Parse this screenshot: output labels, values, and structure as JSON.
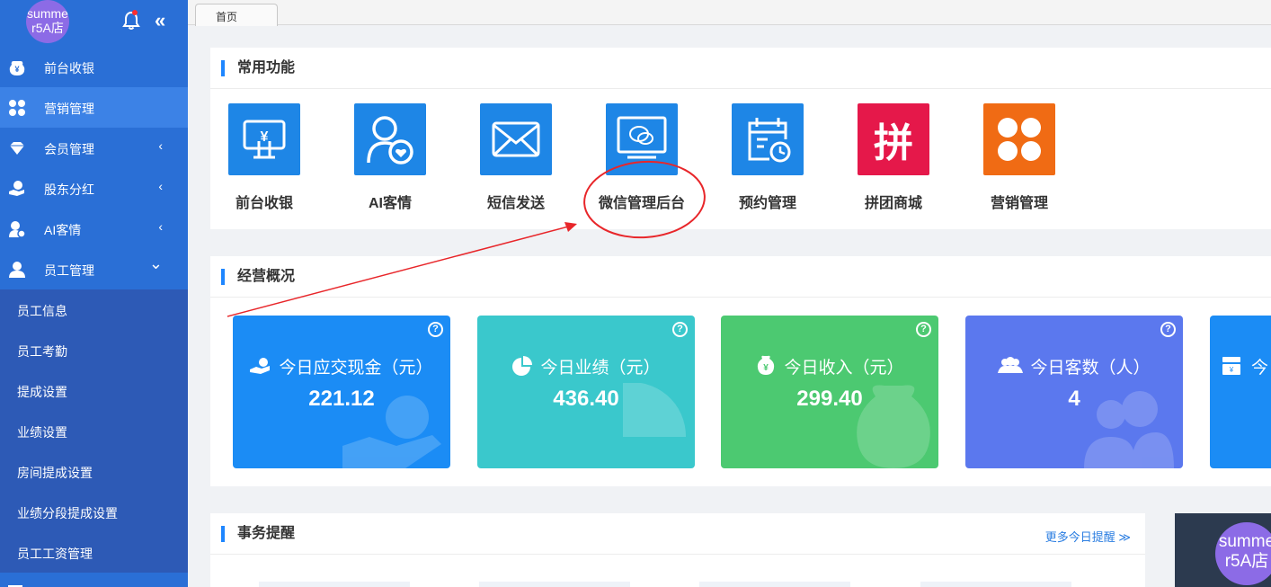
{
  "sidebar": {
    "avatar_text": "summer5A店",
    "avatar_line1": "summe",
    "avatar_line2": "r5A店",
    "collapse_glyph": "«",
    "menu": [
      {
        "label": "前台收银",
        "icon": "yen-coin-icon"
      },
      {
        "label": "营销管理",
        "icon": "clover-icon",
        "active": true
      },
      {
        "label": "会员管理",
        "icon": "diamond-icon",
        "chevron": "‹"
      },
      {
        "label": "股东分红",
        "icon": "hand-coin-icon",
        "chevron": "‹"
      },
      {
        "label": "AI客情",
        "icon": "user-heart-icon",
        "chevron": "‹"
      },
      {
        "label": "员工管理",
        "icon": "user-icon",
        "chevron": "⌄"
      }
    ],
    "sub_items": [
      "员工信息",
      "员工考勤",
      "提成设置",
      "业绩设置",
      "房间提成设置",
      "业绩分段提成设置",
      "员工工资管理"
    ]
  },
  "topbar": {
    "tab_label": "首页"
  },
  "common_functions": {
    "title": "常用功能",
    "items": [
      {
        "label": "前台收银",
        "icon": "cashier-icon",
        "color": "#1e86e6"
      },
      {
        "label": "AI客情",
        "icon": "user-heart-icon",
        "color": "#1e86e6"
      },
      {
        "label": "短信发送",
        "icon": "envelope-icon",
        "color": "#1e86e6"
      },
      {
        "label": "微信管理后台",
        "icon": "wechat-monitor-icon",
        "color": "#1e86e6"
      },
      {
        "label": "预约管理",
        "icon": "calendar-clock-icon",
        "color": "#1e86e6"
      },
      {
        "label": "拼团商城",
        "icon": "pin-group-icon",
        "color": "#e5184a",
        "glyph": "拼"
      },
      {
        "label": "营销管理",
        "icon": "clover-icon",
        "color": "#f06b14"
      }
    ]
  },
  "overview": {
    "title": "经营概况",
    "cards": [
      {
        "title": "今日应交现金（元）",
        "value": "221.12",
        "color": "#1b8cf5",
        "icon": "hand-coin-icon"
      },
      {
        "title": "今日业绩（元）",
        "value": "436.40",
        "color": "#3ac8cc",
        "icon": "pie-chart-icon"
      },
      {
        "title": "今日收入（元）",
        "value": "299.40",
        "color": "#4cc971",
        "icon": "money-bag-icon"
      },
      {
        "title": "今日客数（人）",
        "value": "4",
        "color": "#5b78ee",
        "icon": "users-icon"
      },
      {
        "title": "今",
        "value": "",
        "color": "#1b8cf5",
        "icon": "cash-register-icon"
      }
    ],
    "help_glyph": "?"
  },
  "reminders": {
    "title": "事务提醒",
    "more_link": "更多今日提醒 ≫"
  },
  "widget": {
    "avatar_line1": "summe",
    "avatar_line2": "r5A店"
  },
  "annotation": {
    "color": "#e8262a"
  }
}
